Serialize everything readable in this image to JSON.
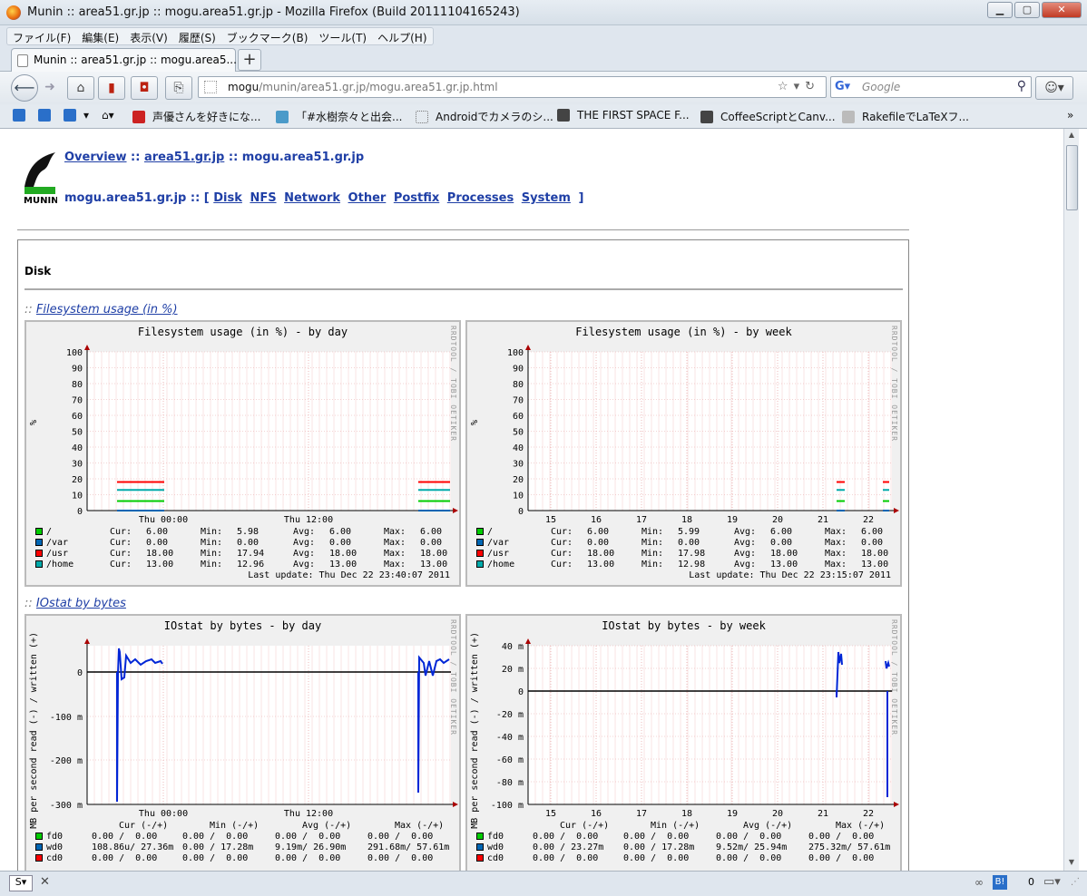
{
  "window": {
    "title": "Munin :: area51.gr.jp :: mogu.area51.gr.jp - Mozilla Firefox (Build 20111104165243)"
  },
  "menu": [
    "ファイル(F)",
    "編集(E)",
    "表示(V)",
    "履歴(S)",
    "ブックマーク(B)",
    "ツール(T)",
    "ヘルプ(H)"
  ],
  "tab": {
    "label": "Munin :: area51.gr.jp :: mogu.area5..."
  },
  "url": {
    "host": "mogu",
    "path": "/munin/area51.gr.jp/mogu.area51.gr.jp.html"
  },
  "search": {
    "placeholder": "Google"
  },
  "bookmarks": [
    "声優さんを好きにな...",
    "「#水樹奈々と出会...",
    "Androidでカメラのシ...",
    "THE FIRST SPACE F...",
    "CoffeeScriptとCanv...",
    "RakefileでLaTeXフ..."
  ],
  "page": {
    "crumb": {
      "overview": "Overview",
      "group": "area51.gr.jp",
      "host": "mogu.area51.gr.jp"
    },
    "host_prefix": "mogu.area51.gr.jp :: [",
    "host_suffix": "]",
    "categories": [
      "Disk",
      "NFS",
      "Network",
      "Other",
      "Postfix",
      "Processes",
      "System"
    ],
    "section": "Disk",
    "graph1_link": "Filesystem usage (in %)",
    "graph2_link": "IOstat by bytes"
  },
  "chart_data": [
    {
      "type": "line",
      "title": "Filesystem usage (in %) - by day",
      "ylabel": "%",
      "ylim": [
        0,
        100
      ],
      "yticks": [
        0,
        10,
        20,
        30,
        40,
        50,
        60,
        70,
        80,
        90,
        100
      ],
      "xticks": [
        "Thu 00:00",
        "Thu 12:00"
      ],
      "series": [
        {
          "name": "/",
          "color": "#00cc00",
          "values": [
            6.0
          ]
        },
        {
          "name": "/var",
          "color": "#0066b3",
          "values": [
            0.0
          ]
        },
        {
          "name": "/usr",
          "color": "#ff0000",
          "values": [
            18.0
          ]
        },
        {
          "name": "/home",
          "color": "#00aaaa",
          "values": [
            13.0
          ]
        }
      ],
      "legend": [
        {
          "name": "/",
          "cur": "6.00",
          "min": "5.98",
          "avg": "6.00",
          "max": "6.00"
        },
        {
          "name": "/var",
          "cur": "0.00",
          "min": "0.00",
          "avg": "0.00",
          "max": "0.00"
        },
        {
          "name": "/usr",
          "cur": "18.00",
          "min": "17.94",
          "avg": "18.00",
          "max": "18.00"
        },
        {
          "name": "/home",
          "cur": "13.00",
          "min": "12.96",
          "avg": "13.00",
          "max": "13.00"
        }
      ],
      "last_update": "Last update: Thu Dec 22 23:40:07 2011"
    },
    {
      "type": "line",
      "title": "Filesystem usage (in %) - by week",
      "ylabel": "%",
      "ylim": [
        0,
        100
      ],
      "yticks": [
        0,
        10,
        20,
        30,
        40,
        50,
        60,
        70,
        80,
        90,
        100
      ],
      "xticks": [
        "15",
        "16",
        "17",
        "18",
        "19",
        "20",
        "21",
        "22"
      ],
      "series": [
        {
          "name": "/",
          "color": "#00cc00",
          "values": [
            6.0
          ]
        },
        {
          "name": "/var",
          "color": "#0066b3",
          "values": [
            0.0
          ]
        },
        {
          "name": "/usr",
          "color": "#ff0000",
          "values": [
            18.0
          ]
        },
        {
          "name": "/home",
          "color": "#00aaaa",
          "values": [
            13.0
          ]
        }
      ],
      "legend": [
        {
          "name": "/",
          "cur": "6.00",
          "min": "5.99",
          "avg": "6.00",
          "max": "6.00"
        },
        {
          "name": "/var",
          "cur": "0.00",
          "min": "0.00",
          "avg": "0.00",
          "max": "0.00"
        },
        {
          "name": "/usr",
          "cur": "18.00",
          "min": "17.98",
          "avg": "18.00",
          "max": "18.00"
        },
        {
          "name": "/home",
          "cur": "13.00",
          "min": "12.98",
          "avg": "13.00",
          "max": "13.00"
        }
      ],
      "last_update": "Last update: Thu Dec 22 23:15:07 2011"
    },
    {
      "type": "line",
      "title": "IOstat by bytes - by day",
      "ylabel": "MB per second read (-) / written (+)",
      "ylim": [
        -300,
        60
      ],
      "yticks": [
        "0",
        "-100 m",
        "-200 m",
        "-300 m"
      ],
      "xticks": [
        "Thu 00:00",
        "Thu 12:00"
      ],
      "legend_header": [
        "Cur (-/+)",
        "Min (-/+)",
        "Avg (-/+)",
        "Max (-/+)"
      ],
      "legend": [
        {
          "name": "fd0",
          "color": "#00cc00",
          "cur": "0.00 /  0.00",
          "min": "0.00 /  0.00",
          "avg": "0.00 /  0.00",
          "max": "0.00 /  0.00"
        },
        {
          "name": "wd0",
          "color": "#0066b3",
          "cur": "108.86u/ 27.36m",
          "min": "0.00 / 17.28m",
          "avg": "9.19m/ 26.90m",
          "max": "291.68m/ 57.61m"
        },
        {
          "name": "cd0",
          "color": "#ff0000",
          "cur": "0.00 /  0.00",
          "min": "0.00 /  0.00",
          "avg": "0.00 /  0.00",
          "max": "0.00 /  0.00"
        }
      ]
    },
    {
      "type": "line",
      "title": "IOstat by bytes - by week",
      "ylabel": "MB per second read (-) / written (+)",
      "ylim": [
        -100,
        40
      ],
      "yticks": [
        "40 m",
        "20 m",
        "0",
        "-20 m",
        "-40 m",
        "-60 m",
        "-80 m",
        "-100 m"
      ],
      "xticks": [
        "15",
        "16",
        "17",
        "18",
        "19",
        "20",
        "21",
        "22"
      ],
      "legend_header": [
        "Cur (-/+)",
        "Min (-/+)",
        "Avg (-/+)",
        "Max (-/+)"
      ],
      "legend": [
        {
          "name": "fd0",
          "color": "#00cc00",
          "cur": "0.00 /  0.00",
          "min": "0.00 /  0.00",
          "avg": "0.00 /  0.00",
          "max": "0.00 /  0.00"
        },
        {
          "name": "wd0",
          "color": "#0066b3",
          "cur": "0.00 / 23.27m",
          "min": "0.00 / 17.28m",
          "avg": "9.52m/ 25.94m",
          "max": "275.32m/ 57.61m"
        },
        {
          "name": "cd0",
          "color": "#ff0000",
          "cur": "0.00 /  0.00",
          "min": "0.00 /  0.00",
          "avg": "0.00 /  0.00",
          "max": "0.00 /  0.00"
        }
      ]
    }
  ],
  "rrdtool": "RRDTOOL / TOBI OETIKER",
  "legend_cols": [
    "Cur:",
    "Min:",
    "Avg:",
    "Max:"
  ],
  "status": {
    "count": "0"
  }
}
